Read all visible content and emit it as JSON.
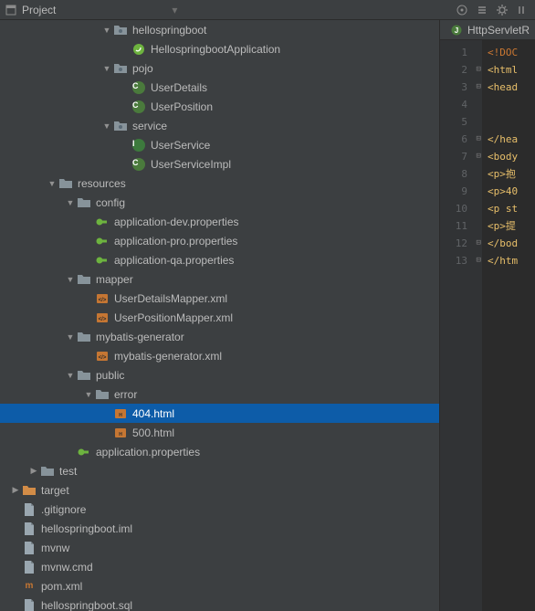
{
  "toolbar": {
    "title": "Project"
  },
  "editor": {
    "tab_label": "HttpServletR",
    "lines": [
      {
        "n": 1,
        "c": "c-kw",
        "t": "<!DOC"
      },
      {
        "n": 2,
        "c": "c-tag",
        "t": "<html"
      },
      {
        "n": 3,
        "c": "c-tag",
        "t": "<head"
      },
      {
        "n": 4,
        "c": "",
        "t": ""
      },
      {
        "n": 5,
        "c": "",
        "t": ""
      },
      {
        "n": 6,
        "c": "c-tag",
        "t": "</hea"
      },
      {
        "n": 7,
        "c": "c-tag",
        "t": "<body"
      },
      {
        "n": 8,
        "c": "c-tag",
        "t": "<p>抱"
      },
      {
        "n": 9,
        "c": "c-tag",
        "t": "<p>40"
      },
      {
        "n": 10,
        "c": "c-tag",
        "t": "<p st"
      },
      {
        "n": 11,
        "c": "c-tag",
        "t": "<p>提"
      },
      {
        "n": 12,
        "c": "c-tag",
        "t": "</bod"
      },
      {
        "n": 13,
        "c": "c-tag",
        "t": "</htm"
      }
    ],
    "fold_lines": [
      2,
      3,
      6,
      7,
      12,
      13
    ]
  },
  "tree": [
    {
      "depth": 5,
      "arrow": "down",
      "icon": "pkg",
      "label": "hellospringboot"
    },
    {
      "depth": 6,
      "arrow": "none",
      "icon": "spring",
      "label": "HellospringbootApplication"
    },
    {
      "depth": 5,
      "arrow": "down",
      "icon": "pkg",
      "label": "pojo"
    },
    {
      "depth": 6,
      "arrow": "none",
      "icon": "class",
      "label": "UserDetails"
    },
    {
      "depth": 6,
      "arrow": "none",
      "icon": "class",
      "label": "UserPosition"
    },
    {
      "depth": 5,
      "arrow": "down",
      "icon": "pkg",
      "label": "service"
    },
    {
      "depth": 6,
      "arrow": "none",
      "icon": "interface",
      "label": "UserService"
    },
    {
      "depth": 6,
      "arrow": "none",
      "icon": "class",
      "label": "UserServiceImpl"
    },
    {
      "depth": 2,
      "arrow": "down",
      "icon": "folder",
      "label": "resources"
    },
    {
      "depth": 3,
      "arrow": "down",
      "icon": "folder",
      "label": "config"
    },
    {
      "depth": 4,
      "arrow": "none",
      "icon": "prop",
      "label": "application-dev.properties"
    },
    {
      "depth": 4,
      "arrow": "none",
      "icon": "prop",
      "label": "application-pro.properties"
    },
    {
      "depth": 4,
      "arrow": "none",
      "icon": "prop",
      "label": "application-qa.properties"
    },
    {
      "depth": 3,
      "arrow": "down",
      "icon": "folder",
      "label": "mapper"
    },
    {
      "depth": 4,
      "arrow": "none",
      "icon": "xml",
      "label": "UserDetailsMapper.xml"
    },
    {
      "depth": 4,
      "arrow": "none",
      "icon": "xml",
      "label": "UserPositionMapper.xml"
    },
    {
      "depth": 3,
      "arrow": "down",
      "icon": "folder",
      "label": "mybatis-generator"
    },
    {
      "depth": 4,
      "arrow": "none",
      "icon": "xml",
      "label": "mybatis-generator.xml"
    },
    {
      "depth": 3,
      "arrow": "down",
      "icon": "folder",
      "label": "public"
    },
    {
      "depth": 4,
      "arrow": "down",
      "icon": "folder",
      "label": "error"
    },
    {
      "depth": 5,
      "arrow": "none",
      "icon": "html",
      "label": "404.html",
      "selected": true
    },
    {
      "depth": 5,
      "arrow": "none",
      "icon": "html",
      "label": "500.html"
    },
    {
      "depth": 3,
      "arrow": "none",
      "icon": "prop",
      "label": "application.properties"
    },
    {
      "depth": 1,
      "arrow": "right",
      "icon": "folder",
      "label": "test"
    },
    {
      "depth": 0,
      "arrow": "right",
      "icon": "folder-o",
      "label": "target"
    },
    {
      "depth": 0,
      "arrow": "none",
      "icon": "file",
      "label": ".gitignore"
    },
    {
      "depth": 0,
      "arrow": "none",
      "icon": "file",
      "label": "hellospringboot.iml"
    },
    {
      "depth": 0,
      "arrow": "none",
      "icon": "file",
      "label": "mvnw"
    },
    {
      "depth": 0,
      "arrow": "none",
      "icon": "file",
      "label": "mvnw.cmd"
    },
    {
      "depth": 0,
      "arrow": "none",
      "icon": "m",
      "label": "pom.xml"
    },
    {
      "depth": 0,
      "arrow": "none",
      "icon": "file",
      "label": "hellospringboot.sql"
    }
  ]
}
